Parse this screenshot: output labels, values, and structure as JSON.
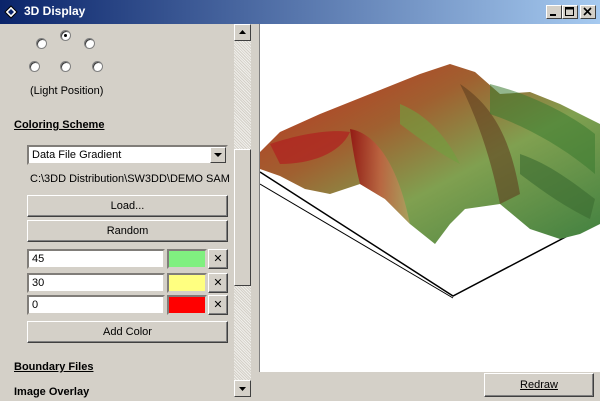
{
  "window": {
    "title": "3D Display"
  },
  "light": {
    "caption": "(Light Position)",
    "selected_index": 1
  },
  "coloring": {
    "heading": "Coloring Scheme",
    "scheme_value": "Data File Gradient",
    "path": "C:\\3DD Distribution\\SW3DD\\DEMO SAM",
    "load_label": "Load...",
    "random_label": "Random",
    "colors": [
      {
        "value": "45",
        "swatch": "#80f080"
      },
      {
        "value": "30",
        "swatch": "#ffff80"
      },
      {
        "value": "0",
        "swatch": "#ff0000"
      }
    ],
    "remove_glyph": "✕",
    "add_color_label": "Add Color"
  },
  "sections": {
    "boundary": "Boundary Files",
    "overlay": "Image Overlay"
  },
  "footer": {
    "redraw_label": "Redraw"
  },
  "icons": {
    "app": "app-diamond-icon",
    "minimize": "minimize-icon",
    "maximize": "maximize-icon",
    "close": "close-icon"
  }
}
